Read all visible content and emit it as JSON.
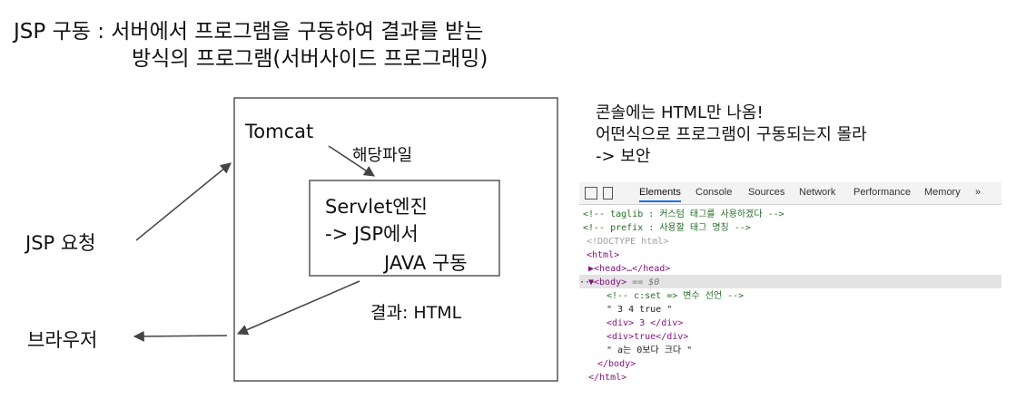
{
  "title_line1": "JSP 구동 : 서버에서 프로그램을 구동하여 결과를 받는",
  "title_line2": "방식의 프로그램(서버사이드 프로그래밍)",
  "labels": {
    "tomcat": "Tomcat",
    "file": "해당파일",
    "servlet_line1": "Servlet엔진",
    "servlet_line2": "-> JSP에서",
    "servlet_line3": "JAVA 구동",
    "result": "결과: HTML",
    "request": "JSP 요청",
    "browser": "브라우저"
  },
  "note": {
    "line1": "콘솔에는 HTML만 나옴!",
    "line2": "어떤식으로 프로그램이 구동되는지 몰라",
    "line3": "-> 보안"
  },
  "devtools": {
    "tabs": [
      "Elements",
      "Console",
      "Sources",
      "Network",
      "Performance",
      "Memory",
      "»"
    ],
    "lines": [
      {
        "text": "<!-- taglib : 커스텀 태그를 사용하겠다 -->",
        "cls": "c-comment"
      },
      {
        "text": "<!-- prefix : 사용할 태그 명칭 -->",
        "cls": "c-comment"
      },
      {
        "text": "<!DOCTYPE html>",
        "cls": "c-doctype"
      },
      {
        "text": "<html>",
        "cls": "c-tag"
      },
      {
        "text": "▶<head>…</head>",
        "cls": "c-tag"
      },
      {
        "text": "▼<body>",
        "cls": "c-tag"
      },
      {
        "text": "<!-- c:set => 변수 선언 -->",
        "cls": "c-comment"
      },
      {
        "text": "\" 3 4 true \"",
        "cls": "c-text"
      },
      {
        "text": "<div> 3 </div>",
        "cls": "c-tag"
      },
      {
        "text": "<div>true</div>",
        "cls": "c-tag"
      },
      {
        "text": "\" a는 0보다 크다 \"",
        "cls": "c-text"
      },
      {
        "text": "</body>",
        "cls": "c-tag"
      },
      {
        "text": "</html>",
        "cls": "c-tag"
      }
    ],
    "body_suffix": "== $0",
    "ellipsis": "···"
  }
}
